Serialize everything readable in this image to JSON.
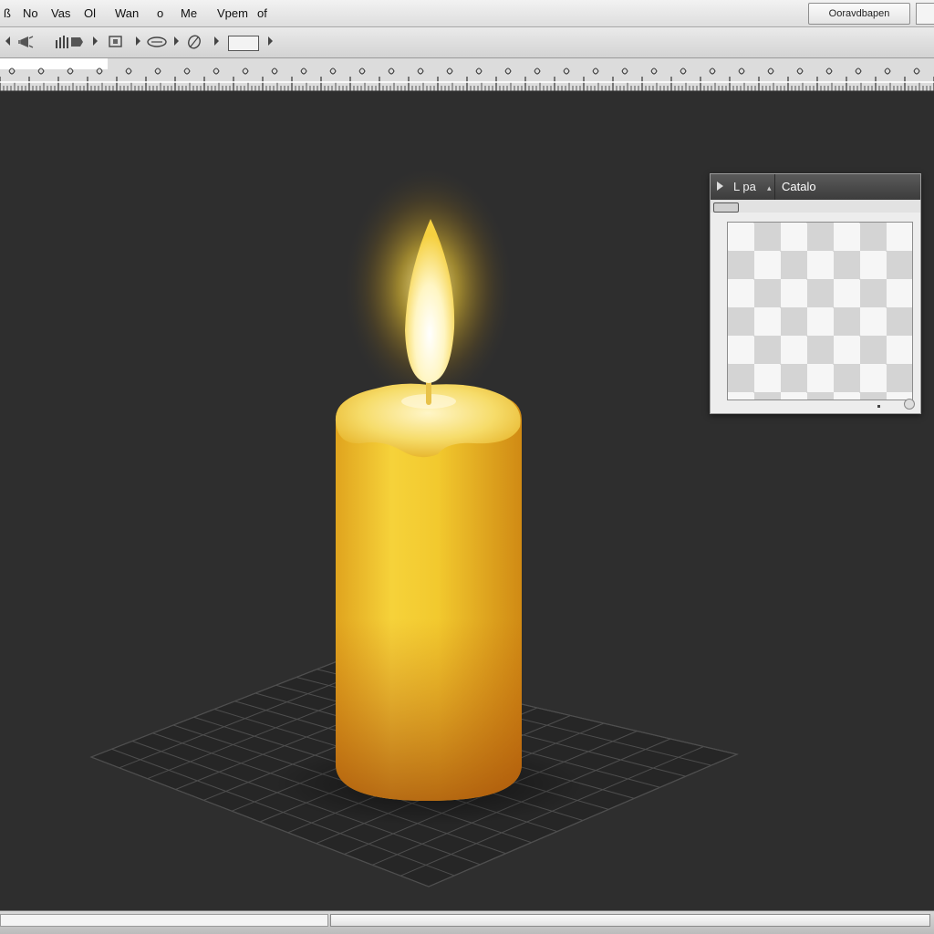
{
  "menubar": {
    "items": [
      "ß",
      "No",
      "Vas",
      "Ol",
      "Wan",
      "o",
      "Me",
      "Vpem",
      "of"
    ],
    "search_label": "Ooravdbapen"
  },
  "toolbar": {
    "icons": [
      "back-icon",
      "megaphone-icon",
      "bar-chart-icon",
      "square-icon",
      "lasso-icon",
      "pen-icon",
      "rectangle-field"
    ]
  },
  "layers_panel": {
    "tabs": [
      "L pa",
      "Catalo"
    ],
    "active_tab": "Catalo"
  },
  "colors": {
    "canvas_bg": "#2e2e2e",
    "candle_light": "#f5d94a",
    "candle_dark": "#c86a10",
    "flame_core": "#fff8d8",
    "glow": "#f0c020"
  }
}
